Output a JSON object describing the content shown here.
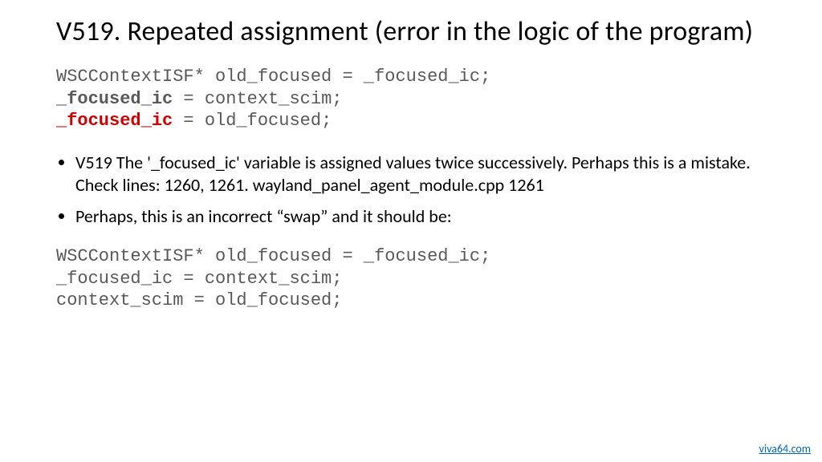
{
  "title": "V519. Repeated assignment (error in the logic of the program)",
  "code1": {
    "line1_pre": "WSCContextISF* old_focused = _focused_ic;",
    "line2_var": "_focused_ic",
    "line2_rest": " = context_scim;",
    "line3_var": "_focused_ic",
    "line3_rest": " = old_focused;"
  },
  "bullets": [
    "V519 The '_focused_ic' variable is assigned values twice successively. Perhaps this is a mistake. Check lines: 1260, 1261. wayland_panel_agent_module.cpp 1261",
    "Perhaps, this is an incorrect “swap” and it should be:"
  ],
  "code2": {
    "line1": "WSCContextISF* old_focused = _focused_ic;",
    "line2": "_focused_ic = context_scim;",
    "line3": "context_scim = old_focused;"
  },
  "footer": "viva64.com"
}
